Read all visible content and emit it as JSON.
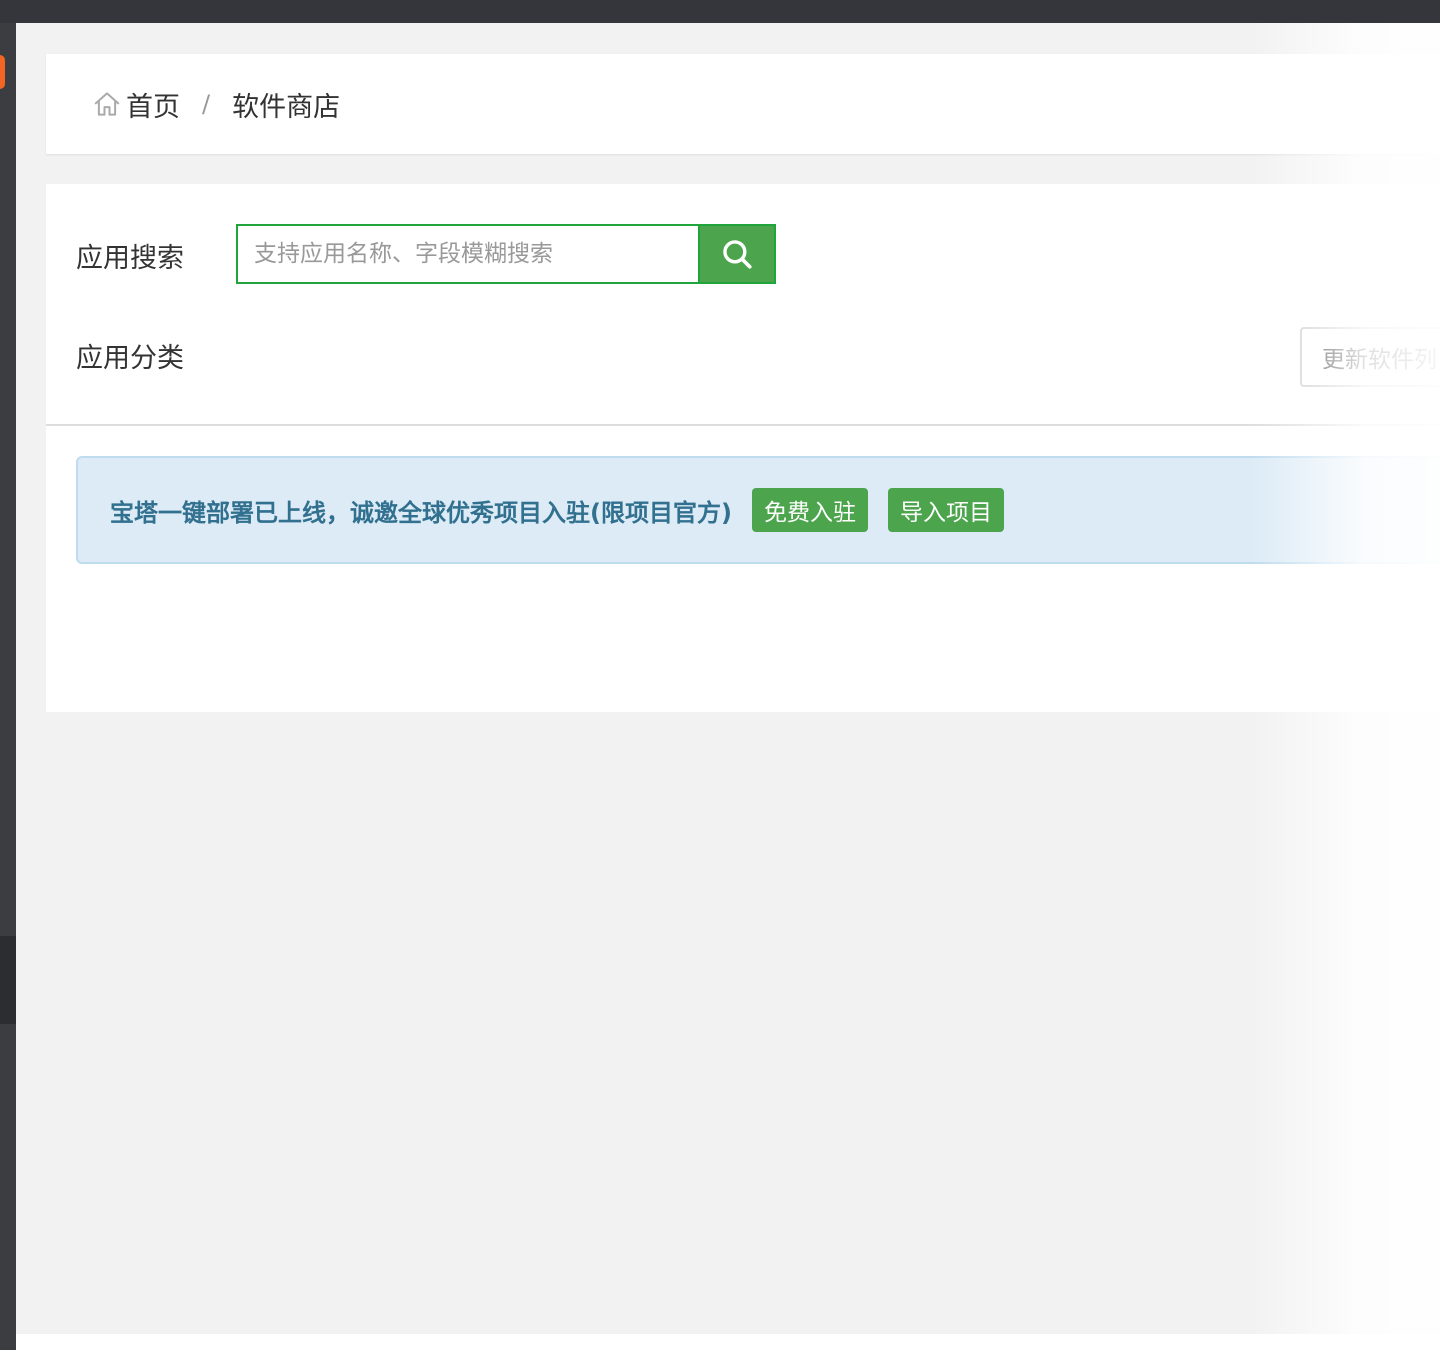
{
  "breadcrumb": {
    "home": "首页",
    "separator": "/",
    "current": "软件商店"
  },
  "search": {
    "label": "应用搜索",
    "placeholder": "支持应用名称、字段模糊搜索",
    "value": ""
  },
  "category": {
    "label": "应用分类"
  },
  "toolbar": {
    "update_label": "更新软件列"
  },
  "alert": {
    "text": "宝塔一键部署已上线，诚邀全球优秀项目入驻(限项目官方)",
    "free_join_label": "免费入驻",
    "import_label": "导入项目"
  },
  "colors": {
    "accent": "#4ca54c",
    "alert_bg": "#dcebf6",
    "alert_text": "#31708f"
  }
}
